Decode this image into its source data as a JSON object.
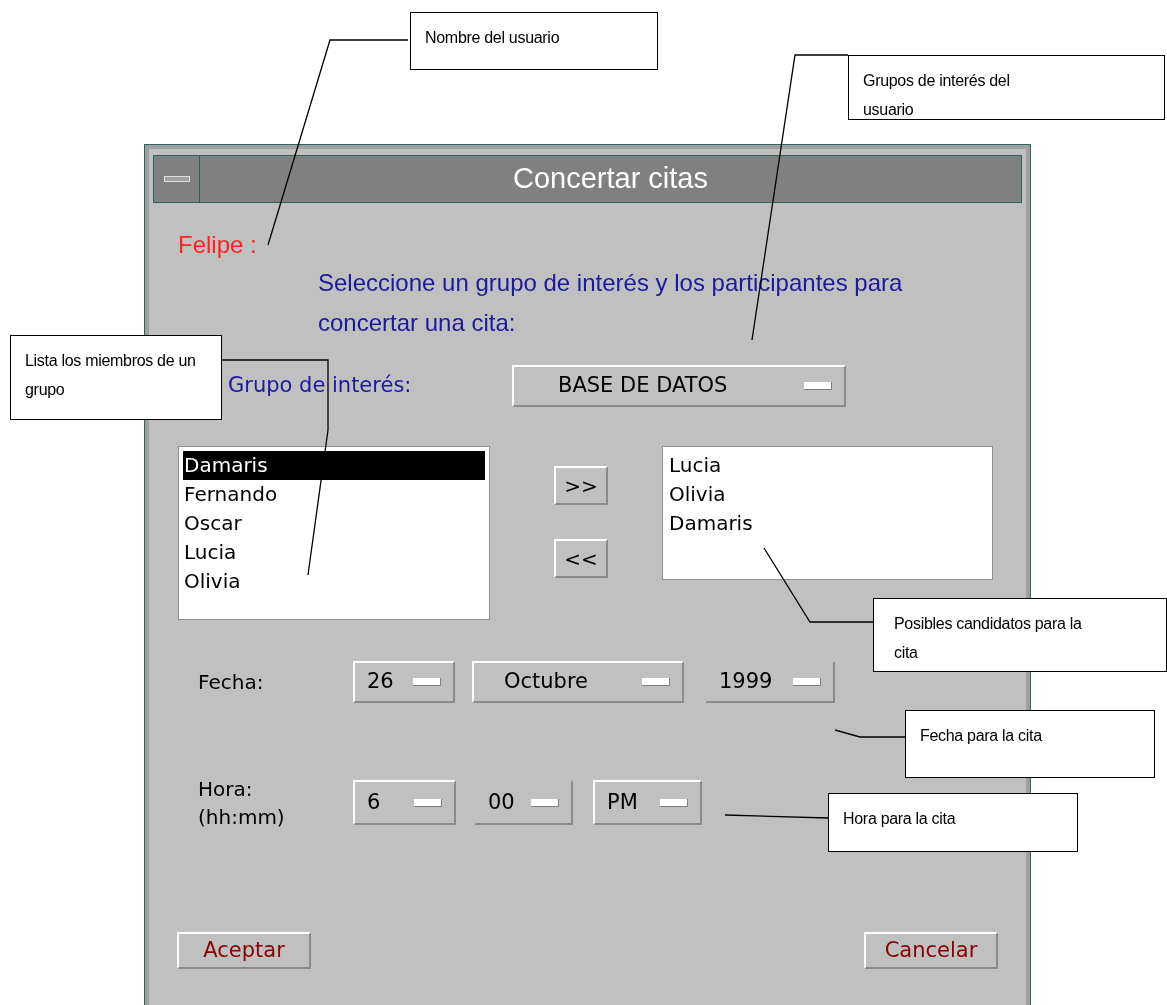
{
  "window": {
    "title": "Concertar citas"
  },
  "user_name": "Felipe :",
  "instruction": "Seleccione un grupo de interés y los participantes para concertar una cita:",
  "group": {
    "label": "Grupo de interés:",
    "value": "BASE DE DATOS"
  },
  "members": [
    {
      "name": "Damaris",
      "selected": true
    },
    {
      "name": "Fernando",
      "selected": false
    },
    {
      "name": "Oscar",
      "selected": false
    },
    {
      "name": "Lucia",
      "selected": false
    },
    {
      "name": "Olivia",
      "selected": false
    }
  ],
  "move_buttons": [
    ">>",
    "<<"
  ],
  "participants": [
    {
      "name": "Lucia"
    },
    {
      "name": "Olivia"
    },
    {
      "name": "Damaris"
    }
  ],
  "date": {
    "label": "Fecha:",
    "day": "26",
    "month": "Octubre",
    "year": "1999"
  },
  "time": {
    "label": "Hora:",
    "format": "(hh:mm)",
    "hour": "6",
    "minute": "00",
    "period": "PM"
  },
  "buttons": [
    "Aceptar",
    "Cancelar"
  ],
  "annotations": [
    {
      "text": "Nombre del usuario"
    },
    {
      "text": "Grupos de interés del usuario"
    },
    {
      "text": "Lista los miembros de un grupo"
    },
    {
      "text": "Posibles candidatos para la cita"
    },
    {
      "text": "Fecha para la cita"
    },
    {
      "text": "Hora para la cita"
    }
  ]
}
